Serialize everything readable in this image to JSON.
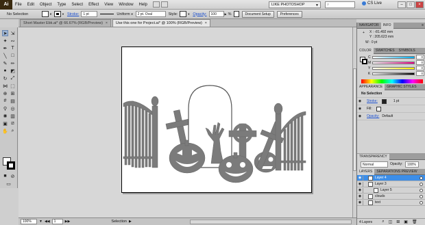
{
  "app": {
    "logo": "Ai",
    "menus": [
      "File",
      "Edit",
      "Object",
      "Type",
      "Select",
      "Effect",
      "View",
      "Window",
      "Help"
    ],
    "workspace": "LIKE PHOTOSHOP",
    "cs_live": "CS Live",
    "window_controls": [
      "–",
      "□",
      "×"
    ]
  },
  "control_bar": {
    "selection": "No Selection",
    "stroke_label": "Stroke:",
    "stroke_weight": "1 pt",
    "profile": "Uniform",
    "brush": "2 pt. Oval",
    "style_label": "Style:",
    "opacity_label": "Opacity:",
    "opacity_value": "100",
    "percent": "%",
    "doc_setup": "Document Setup",
    "preferences": "Preferences"
  },
  "doc_tabs": [
    {
      "label": "Short Master Ebk.ai* @ 66.67% (RGB/Preview)",
      "active": false
    },
    {
      "label": "Use this one for Project.ai* @ 100% (RGB/Preview)",
      "active": true
    }
  ],
  "status_bar": {
    "zoom": "100%",
    "page": "1",
    "tool": "Selection"
  },
  "navigator": {
    "tabs": [
      "NAVIGATOR",
      "INFO"
    ],
    "x": "X : -81.492 mm",
    "y": "Y : 205.623 mm",
    "w": "W : 0 pt"
  },
  "color": {
    "tabs": [
      "COLOR",
      "SWATCHES",
      "SYMBOLS"
    ],
    "channels": [
      {
        "label": "C",
        "value": "0",
        "gradient": "linear-gradient(90deg,#fff,#00aeef)"
      },
      {
        "label": "M",
        "value": "0",
        "gradient": "linear-gradient(90deg,#fff,#ec008c)"
      },
      {
        "label": "Y",
        "value": "0",
        "gradient": "linear-gradient(90deg,#fff,#fff200)"
      },
      {
        "label": "K",
        "value": "0",
        "gradient": "linear-gradient(90deg,#fff,#000)"
      }
    ]
  },
  "appearance": {
    "tabs": [
      "APPEARANCE",
      "GRAPHIC STYLES"
    ],
    "header": "No Selection",
    "stroke_label": "Stroke:",
    "stroke_value": "1 pt",
    "fill_label": "Fill:",
    "opacity_label": "Opacity:",
    "opacity_value": "Default",
    "footer_icons": [
      "■",
      "□",
      "fx",
      "⊘",
      "▤",
      "🗑"
    ]
  },
  "transparency": {
    "tabs": [
      "TRANSPARENCY"
    ],
    "mode": "Normal",
    "opacity_label": "Opacity:",
    "opacity_value": "100%"
  },
  "layers": {
    "tabs": [
      "LAYERS",
      "SEPARATIONS PREVIEW"
    ],
    "items": [
      {
        "name": "Layer 4",
        "indent": 0,
        "selected": true,
        "color": "#3d8ee8"
      },
      {
        "name": "Layer 3",
        "indent": 0,
        "selected": false,
        "color": "#e04a4a"
      },
      {
        "name": "Layer 5",
        "indent": 1,
        "selected": false,
        "color": "#4ab04a"
      },
      {
        "name": "clouds",
        "indent": 0,
        "selected": false,
        "color": "#8a5fd6"
      },
      {
        "name": "text",
        "indent": 0,
        "selected": false,
        "color": "#d6a13a"
      }
    ],
    "count": "4 Layers"
  },
  "colors": {
    "art_gray": "#7b7b7b",
    "art_stroke": "#666666",
    "selection_blue": "#3d8ee8"
  }
}
